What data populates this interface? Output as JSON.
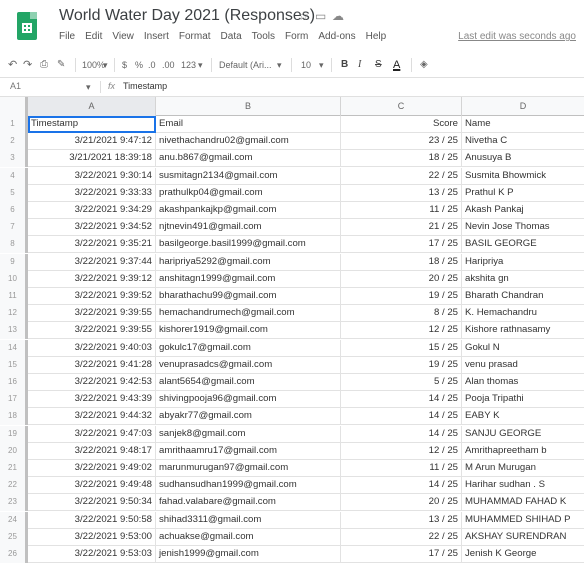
{
  "document": {
    "title": "World Water Day 2021 (Responses)",
    "last_edit": "Last edit was seconds ago"
  },
  "menu": [
    "File",
    "Edit",
    "View",
    "Insert",
    "Format",
    "Data",
    "Tools",
    "Form",
    "Add-ons",
    "Help"
  ],
  "toolbar": {
    "zoom": "100%",
    "currency": "$",
    "percent": "%",
    "decimal_less": ".0",
    "decimal_more": ".00",
    "number_format": "123",
    "font": "Default (Ari...",
    "font_size": "10",
    "bold": "B",
    "italic": "I",
    "strike": "S",
    "text_color": "A"
  },
  "formula_bar": {
    "cell_ref": "A1",
    "fx": "fx",
    "content": "Timestamp"
  },
  "columns": [
    "A",
    "B",
    "C",
    "D"
  ],
  "header_row": [
    "Timestamp",
    "Email",
    "Score",
    "Name"
  ],
  "rows": [
    [
      "3/21/2021 9:47:12",
      "nivethachandru02@gmail.com",
      "23 / 25",
      "Nivetha C"
    ],
    [
      "3/21/2021 18:39:18",
      "anu.b867@gmail.com",
      "18 / 25",
      "Anusuya B"
    ],
    [
      "3/22/2021 9:30:14",
      "susmitagn2134@gmail.com",
      "22 / 25",
      "Susmita Bhowmick"
    ],
    [
      "3/22/2021 9:33:33",
      "prathulkp04@gmail.com",
      "13 / 25",
      "Prathul K P"
    ],
    [
      "3/22/2021 9:34:29",
      "akashpankajkp@gmail.com",
      "11 / 25",
      "Akash Pankaj"
    ],
    [
      "3/22/2021 9:34:52",
      "njtnevin491@gmail.com",
      "21 / 25",
      "Nevin Jose Thomas"
    ],
    [
      "3/22/2021 9:35:21",
      "basilgeorge.basil1999@gmail.com",
      "17 / 25",
      "BASIL GEORGE"
    ],
    [
      "3/22/2021 9:37:44",
      "haripriya5292@gmail.com",
      "18 / 25",
      "Haripriya"
    ],
    [
      "3/22/2021 9:39:12",
      "anshitagn1999@gmail.com",
      "20 / 25",
      "akshita gn"
    ],
    [
      "3/22/2021 9:39:52",
      "bharathachu99@gmail.com",
      "19 / 25",
      "Bharath Chandran"
    ],
    [
      "3/22/2021 9:39:55",
      "hemachandrumech@gmail.com",
      "8 / 25",
      "K. Hemachandru"
    ],
    [
      "3/22/2021 9:39:55",
      "kishorer1919@gmail.com",
      "12 / 25",
      "Kishore rathnasamy"
    ],
    [
      "3/22/2021 9:40:03",
      "gokulc17@gmail.com",
      "15 / 25",
      "Gokul N"
    ],
    [
      "3/22/2021 9:41:28",
      "venuprasadcs@gmail.com",
      "19 / 25",
      "venu prasad"
    ],
    [
      "3/22/2021 9:42:53",
      "alant5654@gmail.com",
      "5 / 25",
      "Alan thomas"
    ],
    [
      "3/22/2021 9:43:39",
      "shivingpooja96@gmail.com",
      "14 / 25",
      "Pooja Tripathi"
    ],
    [
      "3/22/2021 9:44:32",
      "abyakr77@gmail.com",
      "14 / 25",
      "EABY K"
    ],
    [
      "3/22/2021 9:47:03",
      "sanjek8@gmail.com",
      "14 / 25",
      "SANJU GEORGE"
    ],
    [
      "3/22/2021 9:48:17",
      "amrithaamru17@gmail.com",
      "12 / 25",
      "Amrithapreetham b"
    ],
    [
      "3/22/2021 9:49:02",
      "marunmurugan97@gmail.com",
      "11 / 25",
      "M Arun Murugan"
    ],
    [
      "3/22/2021 9:49:48",
      "sudhansudhan1999@gmail.com",
      "14 / 25",
      "Harihar sudhan . S"
    ],
    [
      "3/22/2021 9:50:34",
      "fahad.valabare@gmail.com",
      "20 / 25",
      "MUHAMMAD FAHAD K"
    ],
    [
      "3/22/2021 9:50:58",
      "shihad3311@gmail.com",
      "13 / 25",
      "MUHAMMED SHIHAD P"
    ],
    [
      "3/22/2021 9:53:00",
      "achuakse@gmail.com",
      "22 / 25",
      "AKSHAY SURENDRAN"
    ],
    [
      "3/22/2021 9:53:03",
      "jenish1999@gmail.com",
      "17 / 25",
      "Jenish K George"
    ]
  ]
}
